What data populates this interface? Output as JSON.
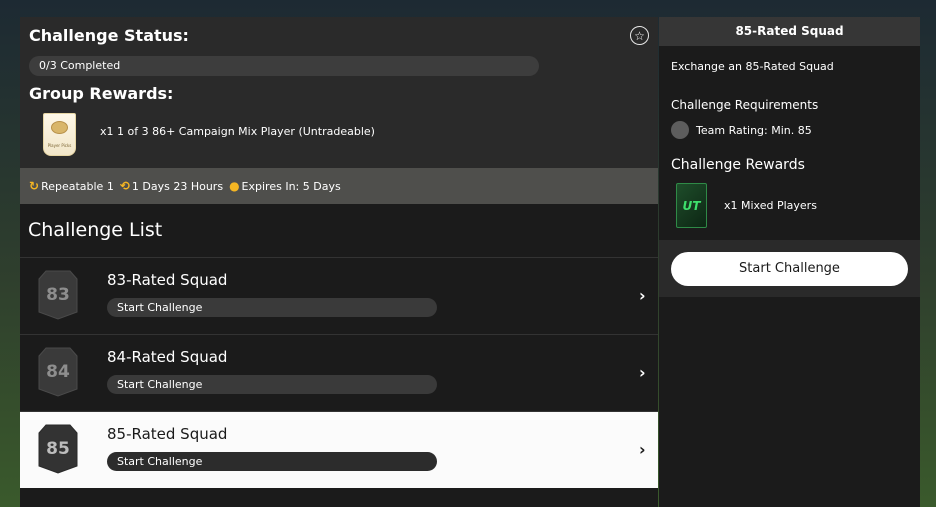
{
  "status": {
    "title": "Challenge Status:",
    "progress_text": "0/3 Completed",
    "progress_fraction": 0,
    "group_rewards_title": "Group Rewards:",
    "group_reward": "x1 1 of 3 86+ Campaign Mix Player (Untradeable)",
    "pack_label": "Player Picks"
  },
  "info": {
    "repeatable": "Repeatable 1",
    "duration": "1 Days 23 Hours",
    "expires": "Expires In: 5 Days"
  },
  "list": {
    "title": "Challenge List",
    "rows": [
      {
        "rating": "83",
        "title": "83-Rated Squad",
        "action": "Start Challenge"
      },
      {
        "rating": "84",
        "title": "84-Rated Squad",
        "action": "Start Challenge"
      },
      {
        "rating": "85",
        "title": "85-Rated Squad",
        "action": "Start Challenge"
      }
    ]
  },
  "detail": {
    "header": "85-Rated Squad",
    "description": "Exchange an 85-Rated Squad",
    "requirements_title": "Challenge Requirements",
    "requirement": "Team Rating: Min. 85",
    "rewards_title": "Challenge Rewards",
    "pack_logo": "UT",
    "reward": "x1 Mixed Players",
    "button": "Start Challenge"
  },
  "colors": {
    "accent_yellow": "#f5b623",
    "pack_green": "#3ee06c"
  }
}
